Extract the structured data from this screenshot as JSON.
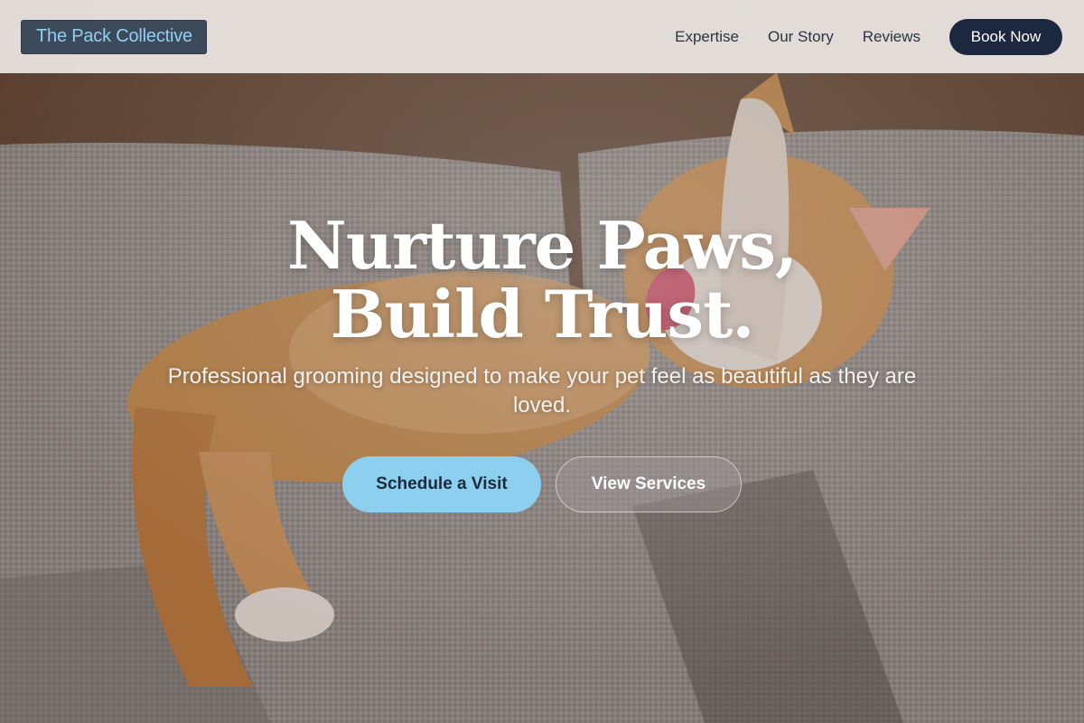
{
  "brand": {
    "name": "The Pack Collective"
  },
  "nav": {
    "links": [
      "Expertise",
      "Our Story",
      "Reviews"
    ],
    "cta_label": "Book Now"
  },
  "hero": {
    "title": "Nurture Paws, Build Trust.",
    "subtitle": "Professional grooming designed to make your pet feel as beautiful as they are loved.",
    "primary_cta": "Schedule a Visit",
    "secondary_cta": "View Services"
  },
  "colors": {
    "header_bg": "#ece6e4",
    "logo_bg": "#3d4a5c",
    "logo_text": "#8fd0f0",
    "book_button": "#1c2740",
    "primary_cta": "#8ccfef"
  }
}
